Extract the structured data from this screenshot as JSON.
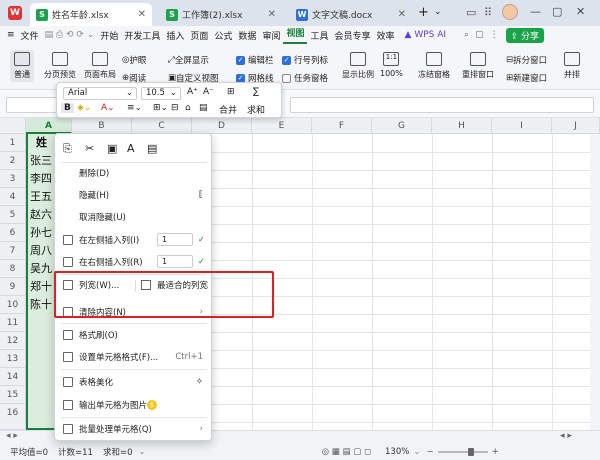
{
  "tabs": [
    {
      "icon": "S",
      "label": "姓名年龄.xlsx",
      "color": "#1aa34a",
      "active": true
    },
    {
      "icon": "S",
      "label": "工作簿(2).xlsx",
      "color": "#1aa34a",
      "active": false
    },
    {
      "icon": "W",
      "label": "文字文稿.docx",
      "color": "#2e6fd8",
      "active": false
    }
  ],
  "menu": {
    "file": "文件",
    "items": [
      "开始",
      "开发工具",
      "插入",
      "页面",
      "公式",
      "数据",
      "审阅",
      "视图",
      "工具",
      "会员专享",
      "效率"
    ],
    "active": "视图",
    "wpsai": "WPS AI",
    "share": "分享"
  },
  "ribbon": {
    "normal": "普通",
    "page_break": "分页预览",
    "page_layout": "页面布局",
    "eye": "护眼",
    "reading": "阅读",
    "fullscreen": "全屏显示",
    "custom": "自定义视图",
    "edit_bar": "编辑栏",
    "gridlines": "网格线",
    "row_col": "行号列标",
    "task_pane": "任务窗格",
    "zoom_ratio": "显示比例",
    "zoom100": "100%",
    "freeze": "冻结窗格",
    "rearrange": "重排窗口",
    "split": "拆分窗口",
    "new_window": "新建窗口",
    "side_by_side": "并排"
  },
  "columns": [
    "A",
    "B",
    "C",
    "D",
    "E",
    "F",
    "G",
    "H",
    "I",
    "J"
  ],
  "rows": [
    "1",
    "2",
    "3",
    "4",
    "5",
    "6",
    "7",
    "8",
    "9",
    "10",
    "11",
    "12",
    "13",
    "14",
    "15",
    "16"
  ],
  "colA": [
    "姓",
    "张三",
    "李四",
    "王五",
    "赵六",
    "孙七",
    "周八",
    "吴九",
    "郑十",
    "陈十",
    "林十"
  ],
  "minitoolbar": {
    "font": "Arial",
    "size": "10.5",
    "bold": "B",
    "merge": "合并",
    "sum": "求和"
  },
  "context_menu": {
    "delete": "删除(D)",
    "hide": "隐藏(H)",
    "unhide": "取消隐藏(U)",
    "insert_left": "在左侧插入列(I)",
    "insert_right": "在右侧插入列(R)",
    "spin_value": "1",
    "col_width": "列宽(W)...",
    "best_fit": "最适合的列宽",
    "clear": "清除内容(N)",
    "format_painter": "格式刷(O)",
    "format_cells": "设置单元格格式(F)...",
    "format_shortcut": "Ctrl+1",
    "beautify": "表格美化",
    "export_image": "输出单元格为图片",
    "batch": "批量处理单元格(Q)"
  },
  "status": {
    "avg": "平均值=0",
    "count": "计数=11",
    "sum": "求和=0",
    "zoom": "130%"
  }
}
